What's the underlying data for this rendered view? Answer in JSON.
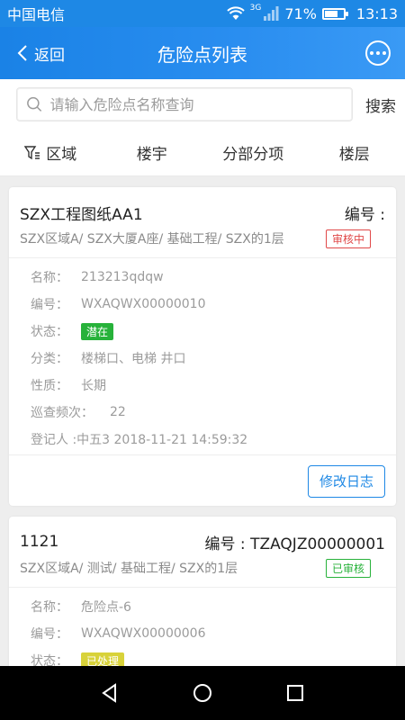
{
  "status_bar": {
    "carrier": "中国电信",
    "network": "3G",
    "battery": "71%",
    "battery_level": 0.71,
    "time": "13:13"
  },
  "nav": {
    "back_label": "返回",
    "title": "危险点列表"
  },
  "search": {
    "placeholder": "请输入危险点名称查询",
    "button_label": "搜索"
  },
  "filters": [
    "区域",
    "楼宇",
    "分部分项",
    "楼层"
  ],
  "cards": [
    {
      "name": "SZX工程图纸AA1",
      "code": "编号 :",
      "path": "SZX区域A/ SZX大厦A座/ 基础工程/ SZX的1层",
      "status": "审核中",
      "status_color": "#e04848",
      "details": [
        {
          "label": "名称：",
          "value": "213213qdqw"
        },
        {
          "label": "编号：",
          "value": "WXAQWX00000010"
        },
        {
          "label": "状态：",
          "badge": "潜在",
          "badge_color": "#27b23a"
        },
        {
          "label": "分类：",
          "value": "楼梯口、电梯 井口"
        },
        {
          "label": "性质：",
          "value": "长期"
        },
        {
          "label": "巡查频次：",
          "value": "22"
        },
        {
          "label": "登记人 : ",
          "value": "中五3 2018-11-21 14:59:32"
        }
      ],
      "log_button": "修改日志"
    },
    {
      "name": "1121",
      "code": "编号 : TZAQJZ00000001",
      "path": "SZX区域A/ 测试/ 基础工程/ SZX的1层",
      "status": "已审核",
      "status_color": "#27b23a",
      "details": [
        {
          "label": "名称：",
          "value": "危险点-6"
        },
        {
          "label": "编号：",
          "value": "WXAQWX00000006"
        },
        {
          "label": "状态：",
          "badge": "已处理",
          "badge_color": "#d8d23a"
        }
      ]
    }
  ]
}
